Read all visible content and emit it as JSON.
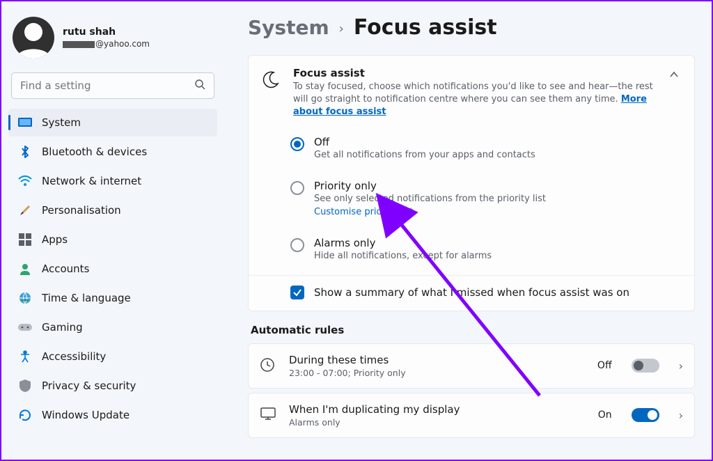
{
  "profile": {
    "name": "rutu shah",
    "email_suffix": "@yahoo.com"
  },
  "search": {
    "placeholder": "Find a setting"
  },
  "sidebar": {
    "items": [
      {
        "label": "System"
      },
      {
        "label": "Bluetooth & devices"
      },
      {
        "label": "Network & internet"
      },
      {
        "label": "Personalisation"
      },
      {
        "label": "Apps"
      },
      {
        "label": "Accounts"
      },
      {
        "label": "Time & language"
      },
      {
        "label": "Gaming"
      },
      {
        "label": "Accessibility"
      },
      {
        "label": "Privacy & security"
      },
      {
        "label": "Windows Update"
      }
    ]
  },
  "breadcrumb": {
    "parent": "System",
    "page": "Focus assist"
  },
  "focus_card": {
    "title": "Focus assist",
    "desc_prefix": "To stay focused, choose which notifications you'd like to see and hear—the rest will go straight to notification centre where you can see them any time.  ",
    "more_link": "More about focus assist",
    "options": {
      "off": {
        "title": "Off",
        "desc": "Get all notifications from your apps and contacts"
      },
      "prio": {
        "title": "Priority only",
        "desc": "See only selected notifications from the priority list",
        "link": "Customise priority list"
      },
      "alarm": {
        "title": "Alarms only",
        "desc": "Hide all notifications, except for alarms"
      }
    },
    "selected": "off",
    "summary": {
      "checked": true,
      "label": "Show a summary of what I missed when focus assist was on"
    }
  },
  "automatic_rules": {
    "heading": "Automatic rules",
    "times": {
      "title": "During these times",
      "desc": "23:00 - 07:00; Priority only",
      "state": "Off",
      "on": false
    },
    "display": {
      "title": "When I'm duplicating my display",
      "desc": "Alarms only",
      "state": "On",
      "on": true
    }
  }
}
